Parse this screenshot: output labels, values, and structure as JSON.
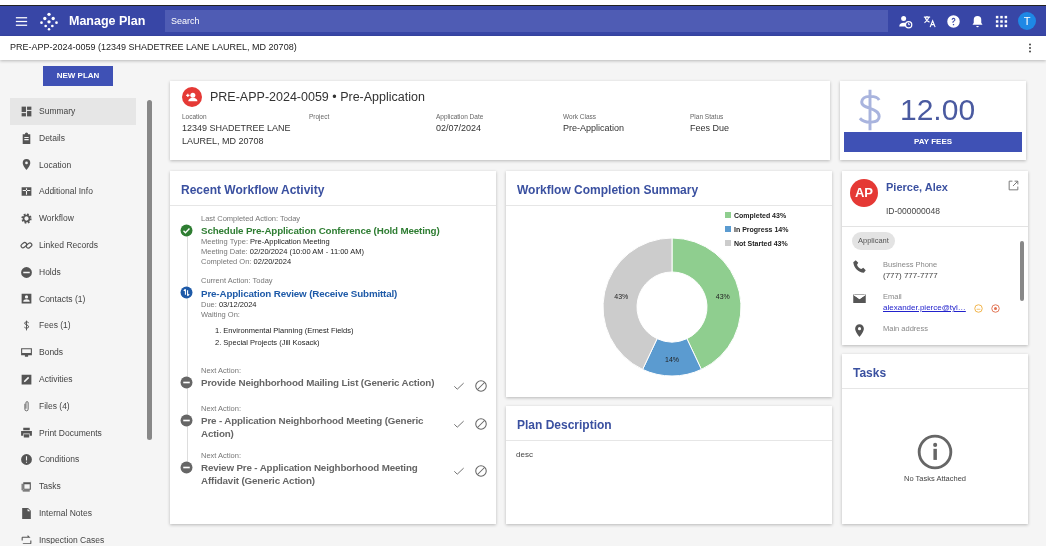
{
  "app_bar": {
    "title": "Manage Plan",
    "search": {
      "placeholder": "Search"
    },
    "avatar": "T"
  },
  "breadcrumb": "PRE-APP-2024-0059 (12349 SHADETREE LANE LAUREL, MD 20708)",
  "sidebar": {
    "new_button": "NEW PLAN",
    "items": [
      {
        "label": "Summary",
        "selected": true
      },
      {
        "label": "Details",
        "selected": false
      },
      {
        "label": "Location",
        "selected": false
      },
      {
        "label": "Additional Info",
        "selected": false
      },
      {
        "label": "Workflow",
        "selected": false
      },
      {
        "label": "Linked Records",
        "selected": false
      },
      {
        "label": "Holds",
        "selected": false
      },
      {
        "label": "Contacts (1)",
        "selected": false
      },
      {
        "label": "Fees (1)",
        "selected": false
      },
      {
        "label": "Bonds",
        "selected": false
      },
      {
        "label": "Activities",
        "selected": false
      },
      {
        "label": "Files (4)",
        "selected": false
      },
      {
        "label": "Print Documents",
        "selected": false
      },
      {
        "label": "Conditions",
        "selected": false
      },
      {
        "label": "Tasks",
        "selected": false
      },
      {
        "label": "Internal Notes",
        "selected": false
      },
      {
        "label": "Inspection Cases",
        "selected": false
      }
    ]
  },
  "plan_header": {
    "title": "PRE-APP-2024-0059 • Pre-Application",
    "fields": [
      {
        "label": "Location",
        "value": [
          "12349 SHADETREE LANE",
          "LAUREL, MD 20708"
        ]
      },
      {
        "label": "Project"
      },
      {
        "label": "Application Date",
        "value": [
          "02/07/2024"
        ]
      },
      {
        "label": "Work Class",
        "value": [
          "Pre-Application"
        ]
      },
      {
        "label": "Plan Status",
        "value": [
          "Fees Due"
        ]
      }
    ]
  },
  "fees": {
    "amount": "12.00",
    "button": "PAY FEES"
  },
  "workflow": {
    "title": "Recent Workflow Activity",
    "items": [
      {
        "kind": "completed",
        "caption": "Last Completed Action: Today",
        "title": "Schedule Pre-Application Conference (Hold Meeting)",
        "details": [
          {
            "label": "Meeting Type:",
            "value": "Pre-Application Meeting"
          },
          {
            "label": "Meeting Date:",
            "value": "02/20/2024 (10:00 AM - 11:00 AM)"
          },
          {
            "label": "Completed On:",
            "value": "02/20/2024"
          }
        ]
      },
      {
        "kind": "current",
        "caption": "Current Action: Today",
        "title": "Pre-Application Review (Receive Submittal)",
        "details": [
          {
            "label": "Due:",
            "value": "03/12/2024"
          },
          {
            "label": "Waiting On:"
          }
        ],
        "waiting": [
          "1. Environmental Planning (Ernest Fields)",
          "2. Special Projects (Jill Kosack)"
        ]
      },
      {
        "kind": "next",
        "caption": "Next Action:",
        "title": "Provide Neighborhood Mailing List (Generic Action)"
      },
      {
        "kind": "next",
        "caption": "Next Action:",
        "title": "Pre - Application Neighborhood Meeting (Generic Action)"
      },
      {
        "kind": "next",
        "caption": "Next Action:",
        "title": "Review Pre - Application Neighborhood Meeting Affidavit (Generic Action)"
      }
    ]
  },
  "completion": {
    "title": "Workflow Completion Summary",
    "chart_data": {
      "type": "donut",
      "categories": [
        "Completed",
        "In Progress",
        "Not Started"
      ],
      "values": [
        43,
        14,
        43
      ],
      "value_labels": [
        "43%",
        "14%",
        "43%"
      ],
      "colors": [
        "#8fce8f",
        "#5b9bd0",
        "#cccccc"
      ],
      "legend": "top-right"
    }
  },
  "description": {
    "title": "Plan Description",
    "text": "desc"
  },
  "contact": {
    "initials": "AP",
    "name": "Pierce, Alex",
    "id": "ID-000000048",
    "role": "Applicant",
    "entries": [
      {
        "kind": "phone",
        "label": "Business Phone",
        "value": "(777) 777-7777"
      },
      {
        "kind": "email",
        "label": "Email",
        "value": "alexander.pierce@tyl…"
      },
      {
        "kind": "address",
        "label": "Main address"
      }
    ]
  },
  "tasks": {
    "title": "Tasks",
    "empty": "No Tasks Attached"
  }
}
